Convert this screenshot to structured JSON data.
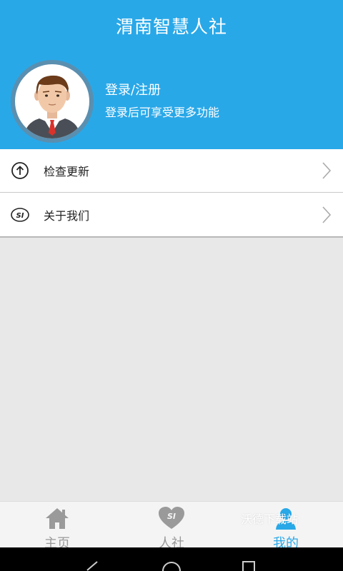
{
  "header": {
    "title": "渭南智慧人社",
    "login_text": "登录/注册",
    "login_hint": "登录后可享受更多功能",
    "bg_color": "#29a8e8"
  },
  "menu": {
    "items": [
      {
        "label": "检查更新",
        "icon": "arrow-up-circle-icon"
      },
      {
        "label": "关于我们",
        "icon": "si-logo-icon"
      }
    ]
  },
  "bottom_nav": {
    "tabs": [
      {
        "label": "主页",
        "icon": "home-icon",
        "active": false
      },
      {
        "label": "人社",
        "icon": "heart-si-icon",
        "active": false
      },
      {
        "label": "我的",
        "icon": "person-icon",
        "active": true
      }
    ],
    "watermark": "沃德下载站",
    "active_color": "#29a8e8",
    "inactive_color": "#999999"
  },
  "system_nav": {
    "buttons": [
      "back-icon",
      "home-circle-icon",
      "recents-icon"
    ]
  }
}
